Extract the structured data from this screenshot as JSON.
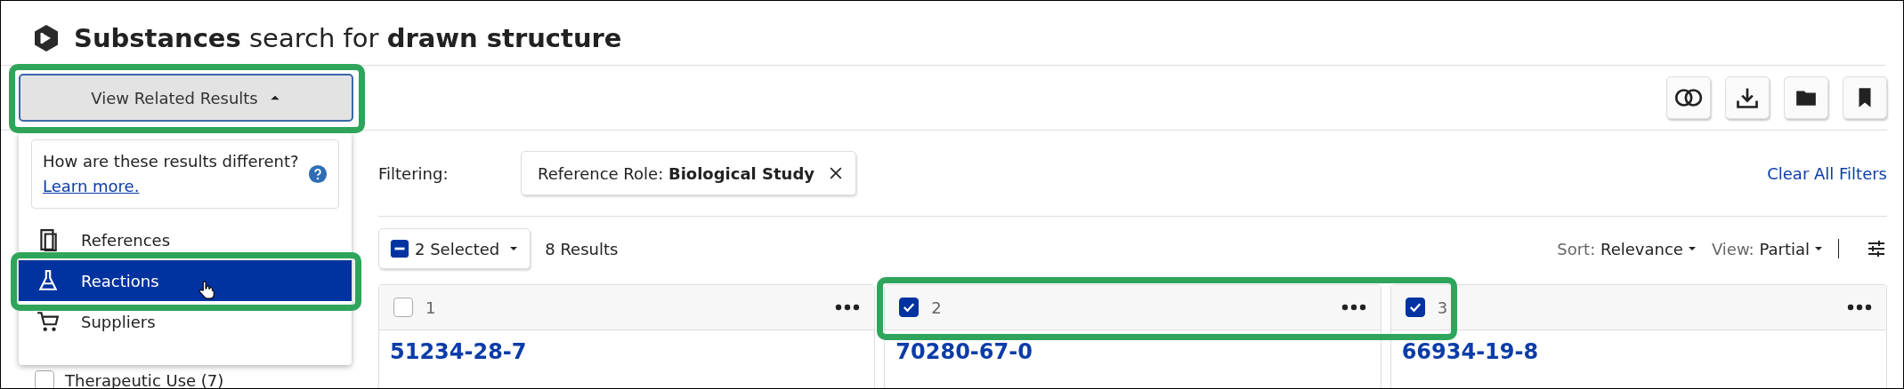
{
  "header": {
    "title": "**Substances** search for **drawn structure**"
  },
  "related_button": {
    "label": "View Related Results",
    "expanded": true,
    "highlighted": true
  },
  "related_menu": {
    "info": "How are these results different?",
    "link": "Learn more.",
    "items": [
      {
        "label": "References",
        "kind": "document",
        "selected": false,
        "highlighted": false
      },
      {
        "label": "Reactions",
        "kind": "flask",
        "selected": true,
        "highlighted": true
      },
      {
        "label": "Suppliers",
        "kind": "cart",
        "selected": false,
        "highlighted": false
      }
    ]
  },
  "sidebar": {
    "filters": [
      {
        "label": "Therapeutic Use (7)",
        "checked": false
      }
    ]
  },
  "filter_bar": {
    "label": "Filtering:",
    "chips": [
      {
        "text": "Reference Role: **Biological Study**"
      }
    ],
    "clear": "Clear All Filters"
  },
  "results_bar": {
    "selection": "2 Selected",
    "count": "8 Results",
    "sort_label": "Sort:",
    "sort": "Relevance",
    "view_label": "View:",
    "view": "Partial"
  },
  "cards": [
    {
      "index": "1",
      "checked": false,
      "cas": "51234-28-7",
      "highlighted": false
    },
    {
      "index": "2",
      "checked": true,
      "cas": "70280-67-0",
      "highlighted": true
    },
    {
      "index": "3",
      "checked": true,
      "cas": "66934-19-8",
      "highlighted": true
    }
  ]
}
